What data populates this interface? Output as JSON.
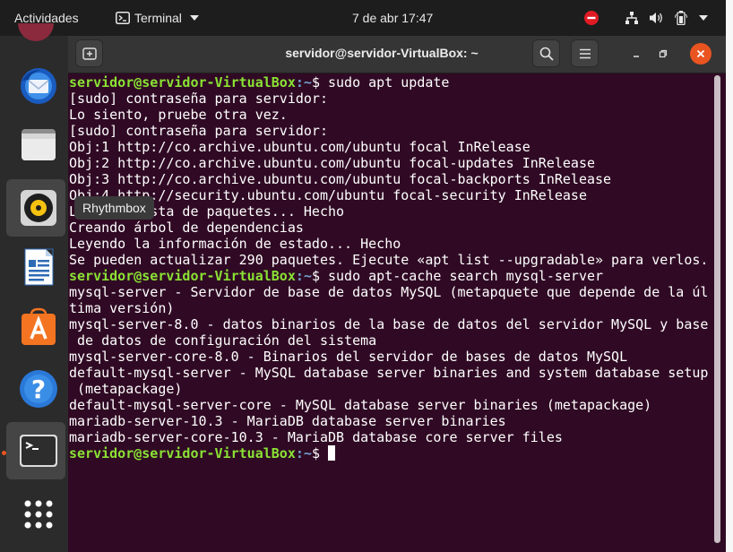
{
  "topbar": {
    "activities": "Actividades",
    "app_menu": "Terminal",
    "clock": "7 de abr  17:47"
  },
  "dock": {
    "items": [
      {
        "name": "thunderbird",
        "active": false
      },
      {
        "name": "files",
        "active": false
      },
      {
        "name": "rhythmbox",
        "active": true
      },
      {
        "name": "libreoffice-writer",
        "active": false
      },
      {
        "name": "ubuntu-software",
        "active": false
      },
      {
        "name": "help",
        "active": false
      },
      {
        "name": "terminal",
        "active": true,
        "running": true
      },
      {
        "name": "show-applications",
        "active": false
      }
    ],
    "tooltip": "Rhythmbox"
  },
  "window": {
    "title": "servidor@servidor-VirtualBox: ~"
  },
  "terminal": {
    "prompt_user": "servidor@servidor-VirtualBox",
    "prompt_path": ":~",
    "lines": [
      {
        "type": "prompt",
        "cmd": "$ sudo apt update"
      },
      {
        "type": "out",
        "text": "[sudo] contraseña para servidor:"
      },
      {
        "type": "out",
        "text": "Lo siento, pruebe otra vez."
      },
      {
        "type": "out",
        "text": "[sudo] contraseña para servidor:"
      },
      {
        "type": "out",
        "text": "Obj:1 http://co.archive.ubuntu.com/ubuntu focal InRelease"
      },
      {
        "type": "out",
        "text": "Obj:2 http://co.archive.ubuntu.com/ubuntu focal-updates InRelease"
      },
      {
        "type": "out",
        "text": "Obj:3 http://co.archive.ubuntu.com/ubuntu focal-backports InRelease"
      },
      {
        "type": "out",
        "text": "Obj:4 http://security.ubuntu.com/ubuntu focal-security InRelease"
      },
      {
        "type": "out",
        "text": "Leyendo lista de paquetes... Hecho"
      },
      {
        "type": "out",
        "text": "Creando árbol de dependencias"
      },
      {
        "type": "out",
        "text": "Leyendo la información de estado... Hecho"
      },
      {
        "type": "out",
        "text": "Se pueden actualizar 290 paquetes. Ejecute «apt list --upgradable» para verlos."
      },
      {
        "type": "prompt",
        "cmd": "$ sudo apt-cache search mysql-server"
      },
      {
        "type": "out",
        "text": "mysql-server - Servidor de base de datos MySQL (metapquete que depende de la úl"
      },
      {
        "type": "out",
        "text": "tima versión)"
      },
      {
        "type": "out",
        "text": "mysql-server-8.0 - datos binarios de la base de datos del servidor MySQL y base"
      },
      {
        "type": "out",
        "text": " de datos de configuración del sistema"
      },
      {
        "type": "out",
        "text": "mysql-server-core-8.0 - Binarios del servidor de bases de datos MySQL"
      },
      {
        "type": "out",
        "text": "default-mysql-server - MySQL database server binaries and system database setup"
      },
      {
        "type": "out",
        "text": " (metapackage)"
      },
      {
        "type": "out",
        "text": "default-mysql-server-core - MySQL database server binaries (metapackage)"
      },
      {
        "type": "out",
        "text": "mariadb-server-10.3 - MariaDB database server binaries"
      },
      {
        "type": "out",
        "text": "mariadb-server-core-10.3 - MariaDB database core server files"
      },
      {
        "type": "prompt",
        "cmd": "$ ",
        "cursor": true
      }
    ]
  },
  "colors": {
    "terminal_bg": "#300a24",
    "prompt_user": "#8ae234",
    "prompt_path": "#729fcf",
    "accent": "#e95420"
  }
}
